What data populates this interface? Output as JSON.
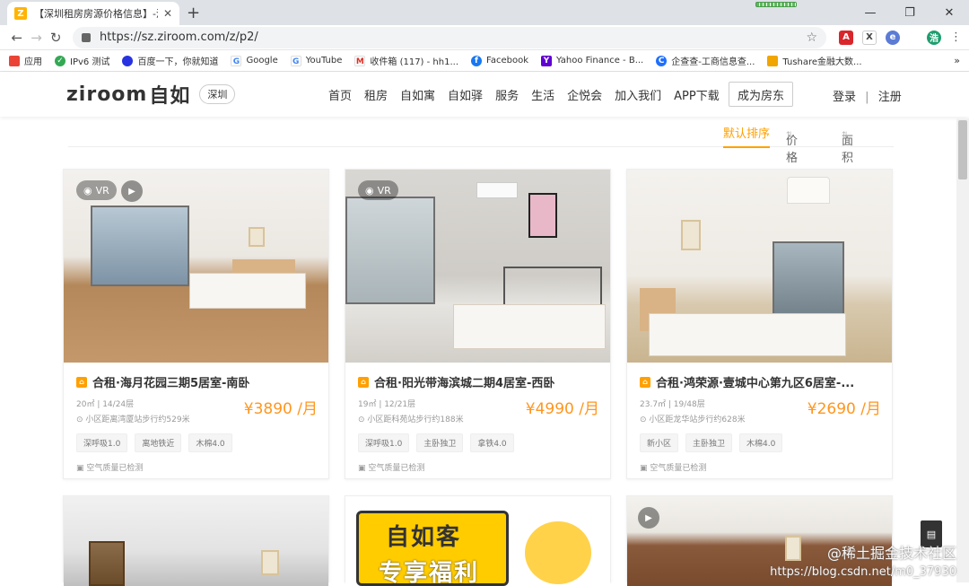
{
  "browser": {
    "tab_title": "【深圳租房房源价格信息】-深圳",
    "url": "https://sz.ziroom.com/z/p2/",
    "bookmarks": [
      {
        "label": "应用",
        "icon": "apps-grid-icon",
        "color": "#ea4335"
      },
      {
        "label": "IPv6 测试",
        "icon": "check-circle-icon",
        "color": "#34a853"
      },
      {
        "label": "百度一下，你就知道",
        "icon": "baidu-paw-icon",
        "color": "#2932e1"
      },
      {
        "label": "Google",
        "icon": "google-g-icon",
        "color": "#4285f4"
      },
      {
        "label": "YouTube",
        "icon": "google-g-icon",
        "color": "#4285f4"
      },
      {
        "label": "收件箱 (117) - hh1...",
        "icon": "gmail-icon",
        "color": "#d93025"
      },
      {
        "label": "Facebook",
        "icon": "facebook-icon",
        "color": "#1877f2"
      },
      {
        "label": "Yahoo Finance - B...",
        "icon": "yahoo-icon",
        "color": "#6001d2"
      },
      {
        "label": "企查查-工商信息查...",
        "icon": "qcc-icon",
        "color": "#1e6fff"
      },
      {
        "label": "Tushare金融大数...",
        "icon": "tushare-icon",
        "color": "#f0a500"
      }
    ],
    "bookmarks_more": "»"
  },
  "site": {
    "logo_text": "ziroom",
    "logo_cn": "自如",
    "city": "深圳",
    "menu": [
      "首页",
      "租房",
      "自如寓",
      "自如驿",
      "服务",
      "生活",
      "企悦会",
      "加入我们",
      "APP下载"
    ],
    "owner_button": "成为房东",
    "login": "登录",
    "register": "注册",
    "divider": "|"
  },
  "sort": {
    "default": "默认排序",
    "price": "价格",
    "area": "面积"
  },
  "listings": [
    {
      "title": "合租·海月花园三期5居室-南卧",
      "meta": "20㎡ | 14/24层",
      "distance": "小区距离湾厦站步行约529米",
      "price": "¥3890 /月",
      "features": [
        "深呼吸1.0",
        "离地铁近",
        "木棉4.0"
      ],
      "air": "空气质量已检测",
      "vr": "VR",
      "has_play": true
    },
    {
      "title": "合租·阳光带海滨城二期4居室-西卧",
      "meta": "19㎡ | 12/21层",
      "distance": "小区距科苑站步行约188米",
      "price": "¥4990 /月",
      "features": [
        "深呼吸1.0",
        "主卧独卫",
        "拿铁4.0"
      ],
      "air": "空气质量已检测",
      "vr": "VR",
      "has_play": false
    },
    {
      "title": "合租·鸿荣源·壹城中心第九区6居室-...",
      "meta": "23.7㎡ | 19/48层",
      "distance": "小区距龙华站步行约628米",
      "price": "¥2690 /月",
      "features": [
        "新小区",
        "主卧独卫",
        "木棉4.0"
      ],
      "air": "空气质量已检测",
      "vr": "",
      "has_play": false
    }
  ],
  "promo": {
    "line1": "自如客",
    "line2": "专享福利"
  },
  "watermark": {
    "line1": "@稀土掘金技术社区",
    "line2": "https://blog.csdn.net/m0_37930"
  },
  "colors": {
    "accent": "#ffa000",
    "price": "#ff961e"
  }
}
